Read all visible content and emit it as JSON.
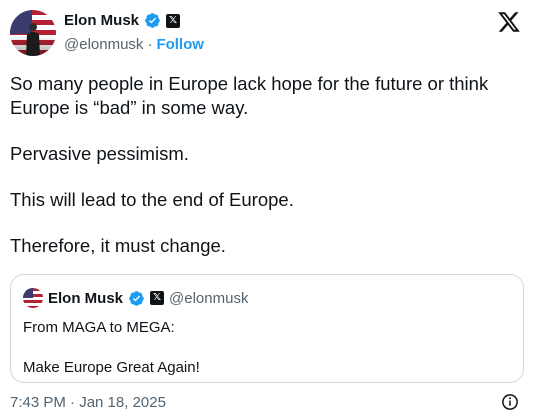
{
  "author": {
    "name": "Elon Musk",
    "handle": "@elonmusk",
    "separator": "·",
    "follow_label": "Follow",
    "badge_label": "𝕏"
  },
  "icons": {
    "avatar": "avatar-image",
    "verified": "verified-check-icon",
    "affiliation": "x-affiliation-icon",
    "logo": "x-logo-icon",
    "info": "info-icon"
  },
  "colors": {
    "accent": "#1d9bf0",
    "text": "#0f1419",
    "muted": "#536471",
    "border": "#cfd9de"
  },
  "tweet": {
    "paragraphs": [
      "So many people in Europe lack hope for the future or think Europe is “bad” in some way.",
      "Pervasive pessimism.",
      "This will lead to the end of Europe.",
      "Therefore, it must change."
    ]
  },
  "quote": {
    "name": "Elon Musk",
    "handle": "@elonmusk",
    "badge_label": "𝕏",
    "lines": [
      "From MAGA to MEGA:",
      "Make Europe Great Again!"
    ]
  },
  "footer": {
    "timestamp": "7:43 PM · Jan 18, 2025"
  }
}
